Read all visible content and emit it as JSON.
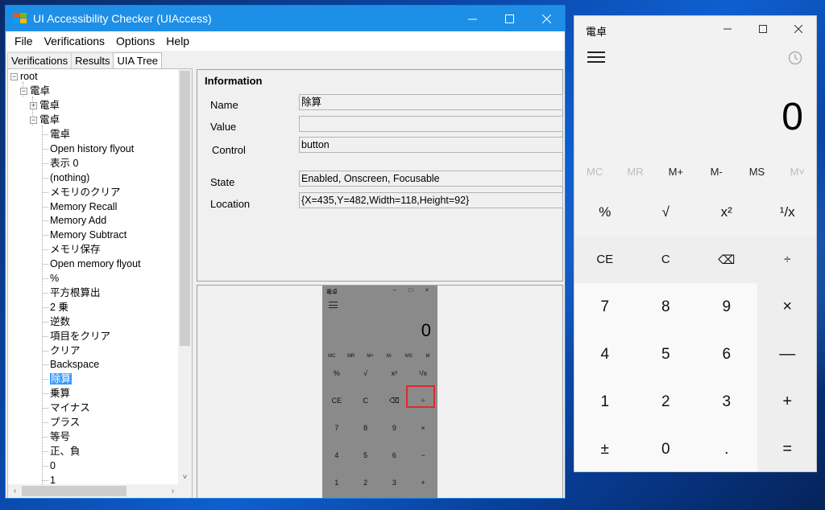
{
  "uia": {
    "title": "UI Accessibility Checker (UIAccess)",
    "menu": [
      "File",
      "Verifications",
      "Options",
      "Help"
    ],
    "tabs": [
      "Verifications",
      "Results",
      "UIA Tree"
    ],
    "tree": {
      "root": "root",
      "level1": "電卓",
      "collapsed_child": "電卓",
      "expanded_child": "電卓",
      "leaves": [
        "電卓",
        "Open history flyout",
        "表示 0",
        "(nothing)",
        "メモリのクリア",
        "Memory Recall",
        "Memory Add",
        "Memory Subtract",
        "メモリ保存",
        "Open memory flyout",
        "%",
        "平方根算出",
        "2 乗",
        "逆数",
        "項目をクリア",
        "クリア",
        "Backspace",
        "除算",
        "乗算",
        "マイナス",
        "プラス",
        "等号",
        "正、負",
        "0",
        "1"
      ],
      "selected_index": 17
    },
    "info": {
      "heading": "Information",
      "name_label": "Name",
      "name_value": "除算",
      "value_label": "Value",
      "value_value": "",
      "control_label": "Control",
      "control_value": "button",
      "state_label": "State",
      "state_value": "Enabled, Onscreen, Focusable",
      "location_label": "Location",
      "location_value": "{X=435,Y=482,Width=118,Height=92}"
    },
    "preview": {
      "title": "電卓",
      "display": "0",
      "memory": [
        "MC",
        "MR",
        "M+",
        "M-",
        "MS",
        "M"
      ],
      "rows": [
        [
          "%",
          "√",
          "x²",
          "¹/x"
        ],
        [
          "CE",
          "C",
          "⌫",
          "÷"
        ],
        [
          "7",
          "8",
          "9",
          "×"
        ],
        [
          "4",
          "5",
          "6",
          "−"
        ],
        [
          "1",
          "2",
          "3",
          "+"
        ],
        [
          "±",
          "0",
          ".",
          "="
        ]
      ]
    }
  },
  "calc": {
    "title": "電卓",
    "display": "0",
    "memory": [
      "MC",
      "MR",
      "M+",
      "M-",
      "MS",
      "M˅"
    ],
    "memory_disabled": [
      true,
      true,
      false,
      false,
      false,
      true
    ],
    "functions": [
      "%",
      "√",
      "x²",
      "¹/x"
    ],
    "keys": [
      [
        "CE",
        "C",
        "⌫",
        "÷"
      ],
      [
        "7",
        "8",
        "9",
        "×"
      ],
      [
        "4",
        "5",
        "6",
        "—"
      ],
      [
        "1",
        "2",
        "3",
        "+"
      ],
      [
        "±",
        "0",
        ".",
        "="
      ]
    ]
  },
  "colors": {
    "uia_titlebar": "#1e8fe6",
    "selection": "#3399ff",
    "highlight_box": "#e0282e"
  }
}
